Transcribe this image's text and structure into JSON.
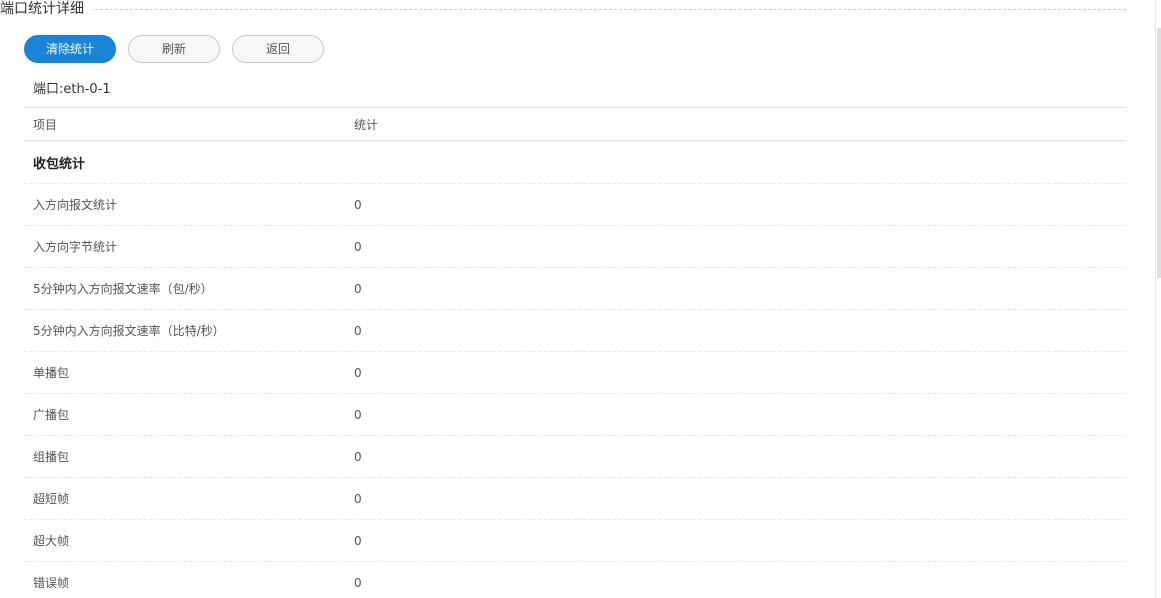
{
  "section": {
    "title": "端口统计详细"
  },
  "toolbar": {
    "clear_label": "清除统计",
    "refresh_label": "刷新",
    "back_label": "返回"
  },
  "port": {
    "label": "端口:eth-0-1"
  },
  "table": {
    "headers": {
      "item": "项目",
      "stat": "统计"
    },
    "group_label": "收包统计",
    "rows": [
      {
        "item": "入方向报文统计",
        "value": "0"
      },
      {
        "item": "入方向字节统计",
        "value": "0"
      },
      {
        "item": "5分钟内入方向报文速率（包/秒）",
        "value": "0"
      },
      {
        "item": "5分钟内入方向报文速率（比特/秒）",
        "value": "0"
      },
      {
        "item": "单播包",
        "value": "0"
      },
      {
        "item": "广播包",
        "value": "0"
      },
      {
        "item": "组播包",
        "value": "0"
      },
      {
        "item": "超短帧",
        "value": "0"
      },
      {
        "item": "超大帧",
        "value": "0"
      },
      {
        "item": "错误帧",
        "value": "0"
      }
    ]
  },
  "colors": {
    "primary": "#1a84d8",
    "border": "#e6e6e6",
    "text": "#333333"
  }
}
